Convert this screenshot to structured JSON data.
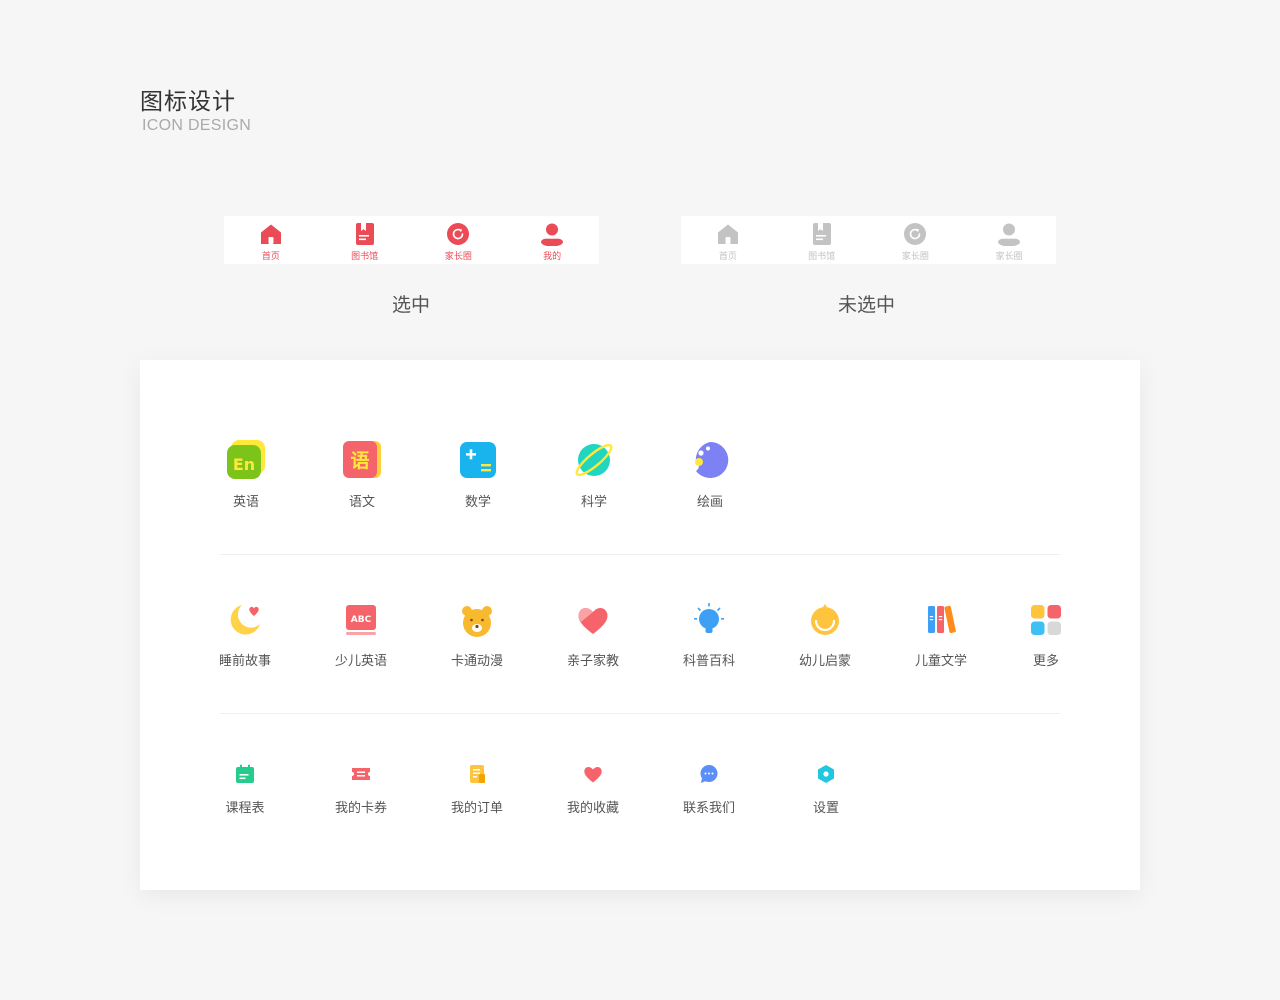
{
  "header": {
    "title": "图标设计",
    "subtitle": "ICON DESIGN"
  },
  "tabbar_selected": {
    "caption": "选中",
    "color": "#ea4b56",
    "items": [
      {
        "label": "首页",
        "icon": "home-icon"
      },
      {
        "label": "图书馆",
        "icon": "book-icon"
      },
      {
        "label": "家长圈",
        "icon": "refresh-circle-icon"
      },
      {
        "label": "我的",
        "icon": "user-icon"
      }
    ]
  },
  "tabbar_unselected": {
    "caption": "未选中",
    "color": "#c3c3c3",
    "items": [
      {
        "label": "首页",
        "icon": "home-icon"
      },
      {
        "label": "图书馆",
        "icon": "book-icon"
      },
      {
        "label": "家长圈",
        "icon": "refresh-circle-icon"
      },
      {
        "label": "家长圈",
        "icon": "user-icon"
      }
    ]
  },
  "subjects": [
    {
      "label": "英语",
      "icon": "english-icon",
      "glyph": "En"
    },
    {
      "label": "语文",
      "icon": "chinese-icon",
      "glyph": "语"
    },
    {
      "label": "数学",
      "icon": "math-icon"
    },
    {
      "label": "科学",
      "icon": "planet-icon"
    },
    {
      "label": "绘画",
      "icon": "palette-icon"
    }
  ],
  "categories": [
    {
      "label": "睡前故事",
      "icon": "moon-heart-icon"
    },
    {
      "label": "少儿英语",
      "icon": "abc-book-icon",
      "glyph": "ABC"
    },
    {
      "label": "卡通动漫",
      "icon": "bear-icon"
    },
    {
      "label": "亲子家教",
      "icon": "heart-icon"
    },
    {
      "label": "科普百科",
      "icon": "lightbulb-icon"
    },
    {
      "label": "幼儿启蒙",
      "icon": "sunrise-icon"
    },
    {
      "label": "儿童文学",
      "icon": "books-icon"
    },
    {
      "label": "更多",
      "icon": "grid-more-icon"
    }
  ],
  "menu": [
    {
      "label": "课程表",
      "icon": "calendar-icon"
    },
    {
      "label": "我的卡券",
      "icon": "coupon-icon"
    },
    {
      "label": "我的订单",
      "icon": "order-icon"
    },
    {
      "label": "我的收藏",
      "icon": "favorite-heart-icon"
    },
    {
      "label": "联系我们",
      "icon": "chat-icon"
    },
    {
      "label": "设置",
      "icon": "settings-hexagon-icon"
    }
  ],
  "colors": {
    "red": "#ea4b56",
    "gray": "#c3c3c3",
    "green": "#25cc8c",
    "coral": "#f4646a",
    "yellow": "#ffc43d",
    "blue": "#3ea0f5",
    "cyan": "#21c6e0",
    "purple": "#7c82f4"
  }
}
